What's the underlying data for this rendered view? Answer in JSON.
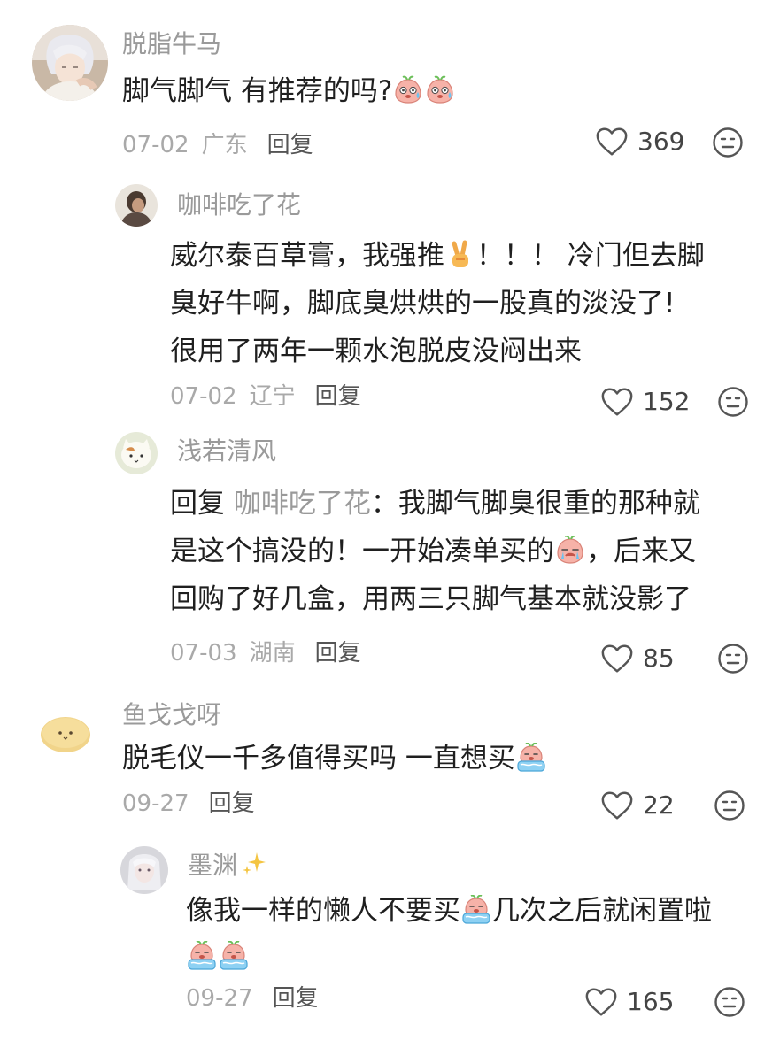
{
  "comments": [
    {
      "user": "脱脂牛马",
      "text_before": "脚气脚气 有推荐的吗?",
      "emojis": [
        "sweat-face-emoji",
        "sweat-face-emoji"
      ],
      "date": "07-02",
      "region": "广东",
      "reply_label": "回复",
      "likes": "369"
    },
    {
      "user": "咖啡吃了花",
      "line1_before": "威尔泰百草膏，我强推",
      "line1_after": "！！！ 冷门但去脚",
      "line2": "臭好牛啊，脚底臭烘烘的一股真的淡没了!",
      "line3": "很用了两年一颗水泡脱皮没闷出来",
      "date": "07-02",
      "region": "辽宁",
      "reply_label": "回复",
      "likes": "152"
    },
    {
      "user": "浅若清风",
      "reply_prefix": "回复",
      "mention": "咖啡吃了花",
      "line1_after": "：我脚气脚臭很重的那种就",
      "line2_before": "是这个搞没的！一开始凑单买的",
      "line2_after": "，后来又",
      "line3": "回购了好几盒，用两三只脚气基本就没影了",
      "date": "07-03",
      "region": "湖南",
      "reply_label": "回复",
      "likes": "85"
    },
    {
      "user": "鱼戈戈呀",
      "text_before": "脱毛仪一千多值得买吗 一直想买",
      "date": "09-27",
      "reply_label": "回复",
      "likes": "22"
    },
    {
      "user": "墨渊",
      "line1_before": "像我一样的懒人不要买",
      "line1_after": "几次之后就闲置啦",
      "date": "09-27",
      "reply_label": "回复",
      "likes": "165"
    }
  ],
  "icons": {
    "like": "heart-outline-icon",
    "dislike": "meh-face-icon",
    "sparkle": "sparkles-icon"
  },
  "colors": {
    "username": "#9a9a9a",
    "text": "#1f1f1f",
    "meta": "#a9a9a9",
    "emoji_pink": "#f4a9a1"
  }
}
